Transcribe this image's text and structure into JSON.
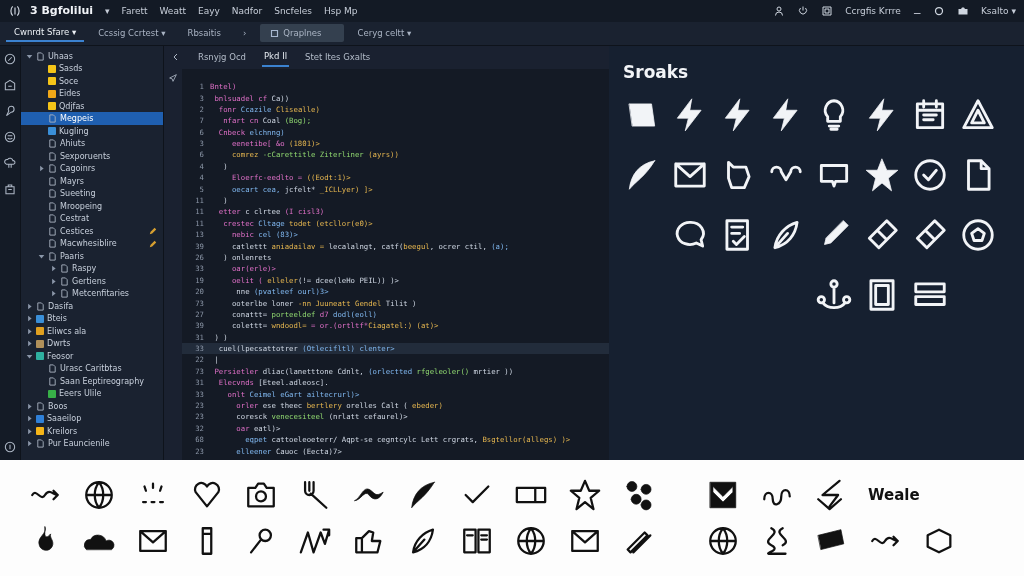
{
  "menubar": {
    "app_name": "3 Bgfolilui",
    "app_caret": "▾",
    "menus": [
      "Farett",
      "Weatt",
      "Eayy",
      "Nadfor",
      "Sncfeles",
      "Hsp Mp"
    ],
    "account": "Ccrgfis Krrre",
    "separator": "⚊",
    "profile": "Ksalto ▾"
  },
  "toolbar": {
    "tabs": [
      {
        "label": "Cwnrdt Sfare ▾",
        "selected": true
      },
      {
        "label": "Ccssig Ccrtest ▾",
        "selected": false
      },
      {
        "label": "Rbsaitis",
        "selected": false
      },
      {
        "label": "›",
        "selected": false
      },
      {
        "label": "Qraplnes",
        "selected": false,
        "boxed": true
      },
      {
        "label": "Ceryg celtt ▾",
        "selected": false
      }
    ]
  },
  "sidebar": {
    "tree": [
      {
        "label": "Uhaas",
        "expanded": true,
        "selected": false,
        "modified": false,
        "children": [
          {
            "label": "Sasds",
            "color": "#f5c518",
            "selected": false,
            "modified": false
          },
          {
            "label": "Soce",
            "color": "#f5c518",
            "selected": false,
            "modified": false
          },
          {
            "label": "Eides",
            "color": "#f0a818",
            "selected": false,
            "modified": false
          },
          {
            "label": "Qdjfas",
            "color": "#f5c518",
            "selected": false,
            "modified": false
          },
          {
            "label": "Megpeis",
            "selected": true,
            "modified": false
          },
          {
            "label": "Kugling",
            "color": "#3a8fd8",
            "selected": false,
            "modified": false
          },
          {
            "label": "Ahiuts",
            "selected": false,
            "modified": false
          },
          {
            "label": "Sexporuents",
            "selected": false,
            "modified": false
          },
          {
            "label": "Cagoinrs",
            "expanded": false,
            "selected": false,
            "modified": false
          },
          {
            "label": "Mayrs",
            "selected": false,
            "modified": false
          },
          {
            "label": "Sueeting",
            "selected": false,
            "modified": false
          },
          {
            "label": "Mroopeing",
            "selected": false,
            "modified": false
          },
          {
            "label": "Cestrat",
            "selected": false,
            "modified": false
          },
          {
            "label": "Cestices",
            "selected": false,
            "modified": true
          },
          {
            "label": "Macwhesiblire",
            "selected": false,
            "modified": true
          },
          {
            "label": "Paaris",
            "expanded": true,
            "selected": false,
            "modified": false,
            "children": [
              {
                "label": "Raspy",
                "expanded": false,
                "selected": false,
                "modified": false
              },
              {
                "label": "Gertiens",
                "expanded": false,
                "selected": false,
                "modified": false
              },
              {
                "label": "Metcenfitaries",
                "expanded": false,
                "selected": false,
                "modified": false
              }
            ]
          }
        ]
      },
      {
        "label": "Dasifa",
        "expanded": false,
        "selected": false,
        "modified": false
      },
      {
        "label": "Bteis",
        "expanded": false,
        "color": "#3a8fd8",
        "selected": false,
        "modified": false
      },
      {
        "label": "Eliwcs ala",
        "expanded": false,
        "color": "#e0a020",
        "selected": false,
        "modified": false
      },
      {
        "label": "Dwrts",
        "expanded": false,
        "color": "#b0905a",
        "selected": false,
        "modified": false
      },
      {
        "label": "Feosor",
        "expanded": true,
        "color": "#2fb0a0",
        "selected": false,
        "modified": false,
        "children": [
          {
            "label": "Urasc Caritbtas",
            "selected": false,
            "modified": false
          },
          {
            "label": "Saan Eeptireography",
            "selected": false,
            "modified": false
          },
          {
            "label": "Eeers Ulile",
            "color": "#38b048",
            "selected": false,
            "modified": false
          }
        ]
      },
      {
        "label": "Boos",
        "expanded": false,
        "selected": false,
        "modified": false
      },
      {
        "label": "Saaeilop",
        "expanded": false,
        "color": "#2f80d8",
        "selected": false,
        "modified": false
      },
      {
        "label": "Kreilors",
        "expanded": false,
        "color": "#f5b518",
        "selected": false,
        "modified": false
      },
      {
        "label": "Pur Eauncienile",
        "expanded": false,
        "selected": false,
        "modified": false
      }
    ]
  },
  "editor": {
    "tabs": [
      {
        "label": "Rsnyjg Ocd",
        "selected": false
      },
      {
        "label": "Pkd Il",
        "selected": true
      },
      {
        "label": "Stet Ites Gxalts",
        "selected": false
      }
    ],
    "lines": [
      {
        "no": "1",
        "current": false,
        "tokens": [
          {
            "kind": "kw",
            "text": "Bntel)"
          }
        ]
      },
      {
        "no": "3",
        "current": false,
        "tokens": [
          {
            "kind": "kw",
            "text": " bnlsuadel cf "
          },
          {
            "kind": "op",
            "text": "Ca))"
          }
        ]
      },
      {
        "no": "2",
        "current": false,
        "tokens": [
          {
            "kind": "kw",
            "text": "  fonr "
          },
          {
            "kind": "var",
            "text": "Ccazile "
          },
          {
            "kind": "fn",
            "text": "Clisealle)"
          }
        ]
      },
      {
        "no": "7",
        "current": false,
        "tokens": [
          {
            "kind": "kw",
            "text": "   nfart cn "
          },
          {
            "kind": "op",
            "text": "Coal "
          },
          {
            "kind": "str",
            "text": "(Bog);"
          }
        ]
      },
      {
        "no": "6",
        "current": false,
        "tokens": [
          {
            "kind": "kw",
            "text": "  Cnbeck "
          },
          {
            "kind": "var",
            "text": "elchnng)"
          }
        ]
      },
      {
        "no": "3",
        "current": false,
        "tokens": [
          {
            "kind": "kw",
            "text": "     eenetibe[ &o "
          },
          {
            "kind": "fn",
            "text": "(1801)>"
          }
        ]
      },
      {
        "no": "6",
        "current": false,
        "tokens": [
          {
            "kind": "fn",
            "text": "     comrez "
          },
          {
            "kind": "str",
            "text": "-cCarettitle Ziterliner "
          },
          {
            "kind": "fn",
            "text": "(ayrs))"
          }
        ]
      },
      {
        "no": "4",
        "current": false,
        "tokens": [
          {
            "kind": "op",
            "text": "   )"
          }
        ]
      },
      {
        "no": "4",
        "current": false,
        "tokens": [
          {
            "kind": "kw",
            "text": "     Eloerfc-eedlto = "
          },
          {
            "kind": "fn",
            "text": "((Eodt:1)>"
          }
        ]
      },
      {
        "no": "5",
        "current": false,
        "tokens": [
          {
            "kind": "var",
            "text": "     oecart cea, "
          },
          {
            "kind": "op",
            "text": "jcfelt* "
          },
          {
            "kind": "fn",
            "text": "_ICLLyer) ]>"
          }
        ]
      },
      {
        "no": "11",
        "current": false,
        "tokens": [
          {
            "kind": "op",
            "text": "   )"
          }
        ]
      },
      {
        "no": "11",
        "current": false,
        "tokens": [
          {
            "kind": "kw",
            "text": "  etter "
          },
          {
            "kind": "op",
            "text": "c clrtee "
          },
          {
            "kind": "kw",
            "text": "(I cisl3)"
          }
        ]
      },
      {
        "no": "11",
        "current": false,
        "tokens": [
          {
            "kind": "kw",
            "text": "   crestec "
          },
          {
            "kind": "var",
            "text": "Cltage "
          },
          {
            "kind": "fn",
            "text": "todet (etcllor(e0)>"
          }
        ]
      },
      {
        "no": "13",
        "current": false,
        "tokens": [
          {
            "kind": "kw",
            "text": "     nebic "
          },
          {
            "kind": "var",
            "text": "cel (83)>"
          }
        ]
      },
      {
        "no": "39",
        "current": false,
        "tokens": [
          {
            "kind": "op",
            "text": "     catlettt "
          },
          {
            "kind": "fn",
            "text": "aniadailav = "
          },
          {
            "kind": "op",
            "text": "lecalalngt, catf("
          },
          {
            "kind": "fn",
            "text": "beegul"
          },
          {
            "kind": "op",
            "text": ", ocrer ctil, "
          },
          {
            "kind": "var",
            "text": "(a);"
          }
        ]
      },
      {
        "no": "26",
        "current": false,
        "tokens": [
          {
            "kind": "op",
            "text": "   ) onlenrets"
          }
        ]
      },
      {
        "no": "33",
        "current": false,
        "tokens": [
          {
            "kind": "kw",
            "text": "     oar(erle)>"
          }
        ]
      },
      {
        "no": "19",
        "current": false,
        "tokens": [
          {
            "kind": "kw",
            "text": "     oelit ( "
          },
          {
            "kind": "fn",
            "text": "elleler"
          },
          {
            "kind": "op",
            "text": "(!= dcee(leHo PEIL)) )>"
          }
        ]
      },
      {
        "no": "20",
        "current": false,
        "tokens": [
          {
            "kind": "op",
            "text": "      nne "
          },
          {
            "kind": "var",
            "text": "(pvatleef ourl)3>"
          }
        ]
      },
      {
        "no": "73",
        "current": false,
        "tokens": [
          {
            "kind": "op",
            "text": "     ooterlbe loner "
          },
          {
            "kind": "fn",
            "text": "-nn Juuneatt Gendel "
          },
          {
            "kind": "op",
            "text": "Tilit )"
          }
        ]
      },
      {
        "no": "27",
        "current": false,
        "tokens": [
          {
            "kind": "op",
            "text": "     conattt= "
          },
          {
            "kind": "str",
            "text": "porteeldef "
          },
          {
            "kind": "kw",
            "text": "d7 "
          },
          {
            "kind": "var",
            "text": "dodl(eoll)"
          }
        ]
      },
      {
        "no": "39",
        "current": false,
        "tokens": [
          {
            "kind": "op",
            "text": "     colettt= "
          },
          {
            "kind": "fn",
            "text": "wndoodl= "
          },
          {
            "kind": "kw",
            "text": "= or.(ortltf*"
          },
          {
            "kind": "fn",
            "text": "Ciagatel:) (at)>"
          }
        ]
      },
      {
        "no": "31",
        "current": false,
        "tokens": [
          {
            "kind": "op",
            "text": " ) )"
          }
        ]
      },
      {
        "no": "33",
        "current": true,
        "tokens": [
          {
            "kind": "op",
            "text": "  cuel(lpecsattotrer "
          },
          {
            "kind": "var",
            "text": "(Otlecifltl) clenter>"
          }
        ]
      },
      {
        "no": "22",
        "current": false,
        "tokens": [
          {
            "kind": "op",
            "text": " |"
          }
        ]
      },
      {
        "no": "73",
        "current": false,
        "tokens": [
          {
            "kind": "kw",
            "text": " Persietler "
          },
          {
            "kind": "op",
            "text": "dliac(lanetttone Cdnlt, "
          },
          {
            "kind": "var",
            "text": "(orlectted "
          },
          {
            "kind": "str",
            "text": "rfgeleoler() "
          },
          {
            "kind": "op",
            "text": "mrtier ))"
          }
        ]
      },
      {
        "no": "31",
        "current": false,
        "tokens": [
          {
            "kind": "kw",
            "text": "  Elecvnds "
          },
          {
            "kind": "op",
            "text": "[Eteel.adleosc]."
          }
        ]
      },
      {
        "no": "33",
        "current": false,
        "tokens": [
          {
            "kind": "kw",
            "text": "    onlt "
          },
          {
            "kind": "var",
            "text": "Ceimel eGart ailtecrurl)>"
          }
        ]
      },
      {
        "no": "23",
        "current": false,
        "tokens": [
          {
            "kind": "kw",
            "text": "      orler "
          },
          {
            "kind": "op",
            "text": "ese theec "
          },
          {
            "kind": "fn",
            "text": "bertlery "
          },
          {
            "kind": "op",
            "text": "orelles Calt ( "
          },
          {
            "kind": "fn",
            "text": "ebeder)"
          }
        ]
      },
      {
        "no": "23",
        "current": false,
        "tokens": [
          {
            "kind": "op",
            "text": "      coresck "
          },
          {
            "kind": "str",
            "text": "venecesiteel "
          },
          {
            "kind": "op",
            "text": "(nrlatt cefaurel)>"
          }
        ]
      },
      {
        "no": "32",
        "current": false,
        "tokens": [
          {
            "kind": "kw",
            "text": "      oar "
          },
          {
            "kind": "op",
            "text": "eatl)>"
          }
        ]
      },
      {
        "no": "68",
        "current": false,
        "tokens": [
          {
            "kind": "var",
            "text": "        eqpet "
          },
          {
            "kind": "op",
            "text": "cattoeleoeterr/ Aqpt-se cegntcylc Lett crgrats, "
          },
          {
            "kind": "fn",
            "text": "Bsgtellor(allegs) )>"
          }
        ]
      },
      {
        "no": "23",
        "current": false,
        "tokens": [
          {
            "kind": "var",
            "text": "      elleener "
          },
          {
            "kind": "op",
            "text": "Cauoc (Eecta)7>"
          }
        ]
      }
    ]
  },
  "icon_panel": {
    "title": "Sroaks"
  },
  "bottom_strip": {
    "wordmark": "Weale"
  }
}
